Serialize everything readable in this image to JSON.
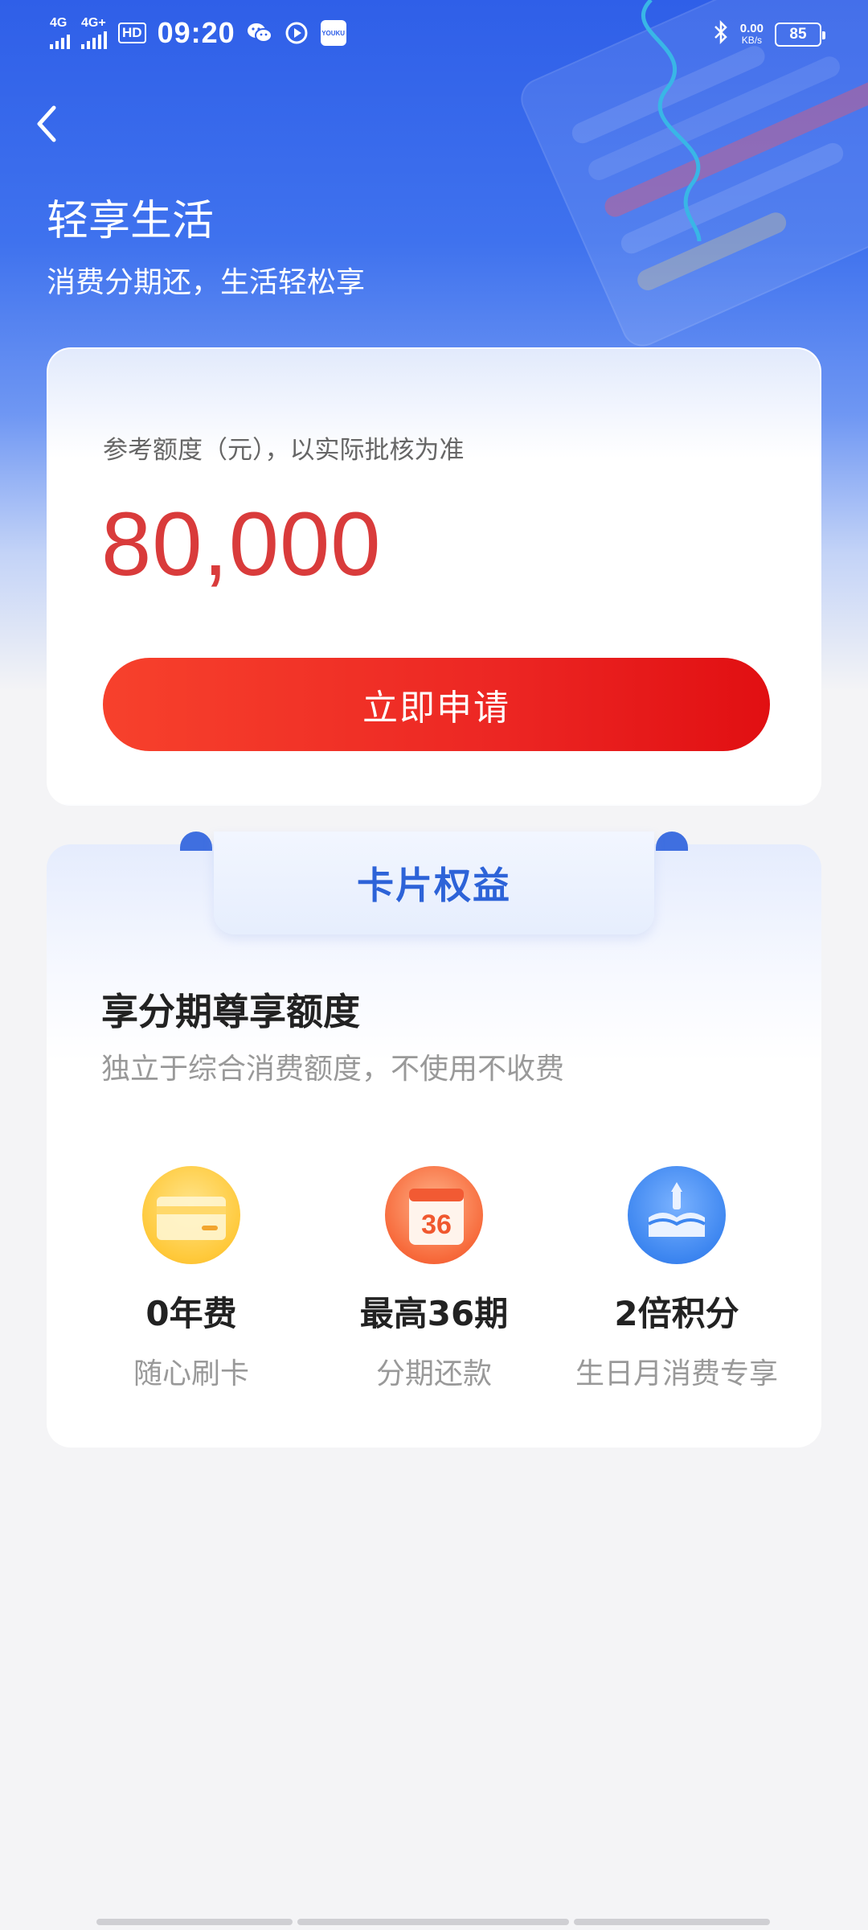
{
  "status_bar": {
    "signal1": "4G",
    "signal2": "4G+",
    "hd_label": "HD",
    "time": "09:20",
    "youku_label": "YOUKU",
    "net_speed": "0.00",
    "net_unit": "KB/s",
    "battery": "85"
  },
  "header": {
    "title": "轻享生活",
    "subtitle": "消费分期还，生活轻松享"
  },
  "credit": {
    "label": "参考额度（元），以实际批核为准",
    "amount": "80,000",
    "apply_label": "立即申请"
  },
  "benefits": {
    "tab_label": "卡片权益",
    "title": "享分期尊享额度",
    "subtitle": "独立于综合消费额度，不使用不收费",
    "features": [
      {
        "title": "0年费",
        "subtitle": "随心刷卡",
        "icon": "card-icon"
      },
      {
        "title": "最高36期",
        "subtitle": "分期还款",
        "icon": "calendar-icon",
        "icon_text": "36"
      },
      {
        "title": "2倍积分",
        "subtitle": "生日月消费专享",
        "icon": "birthday-cake-icon"
      }
    ]
  },
  "colors": {
    "primary_blue": "#2f5fe8",
    "amount_red": "#d93b3b",
    "button_red": "#ec2623",
    "tab_blue": "#2d63d8"
  }
}
